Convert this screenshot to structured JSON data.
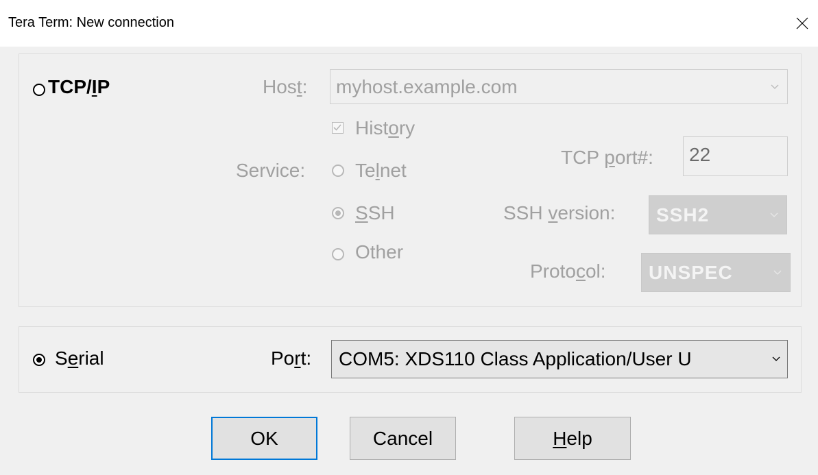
{
  "window": {
    "title": "Tera Term: New connection",
    "close_glyph": "✕"
  },
  "tcpip": {
    "radio_label_pre": "TCP/",
    "radio_label_ul": "I",
    "radio_label_post": "P",
    "host_label_pre": "Hos",
    "host_label_ul": "t",
    "host_label_post": ":",
    "host_value": "myhost.example.com",
    "history_label_pre": "Hist",
    "history_label_ul": "o",
    "history_label_post": "ry",
    "history_checked": true,
    "service_label": "Service:",
    "telnet_pre": "Te",
    "telnet_ul": "l",
    "telnet_post": "net",
    "ssh_ul": "S",
    "ssh_post": "SH",
    "other_label": "Other",
    "tcp_port_pre": "TCP ",
    "tcp_port_ul": "p",
    "tcp_port_post": "ort#:",
    "tcp_port_value": "22",
    "ssh_version_pre": "SSH ",
    "ssh_version_ul": "v",
    "ssh_version_post": "ersion:",
    "ssh_version_value": "SSH2",
    "protocol_pre": "Proto",
    "protocol_ul": "c",
    "protocol_post": "ol:",
    "protocol_value": "UNSPEC"
  },
  "serial": {
    "radio_label_pre": "S",
    "radio_label_ul": "e",
    "radio_label_post": "rial",
    "port_label_pre": "Po",
    "port_label_ul": "r",
    "port_label_post": "t:",
    "port_value": "COM5: XDS110 Class Application/User U"
  },
  "buttons": {
    "ok": "OK",
    "cancel": "Cancel",
    "help_ul": "H",
    "help_post": "elp"
  },
  "colors": {
    "dialog_bg": "#f0f0f0",
    "disabled_text": "#a0a0a0",
    "focus_border": "#0078d7"
  }
}
